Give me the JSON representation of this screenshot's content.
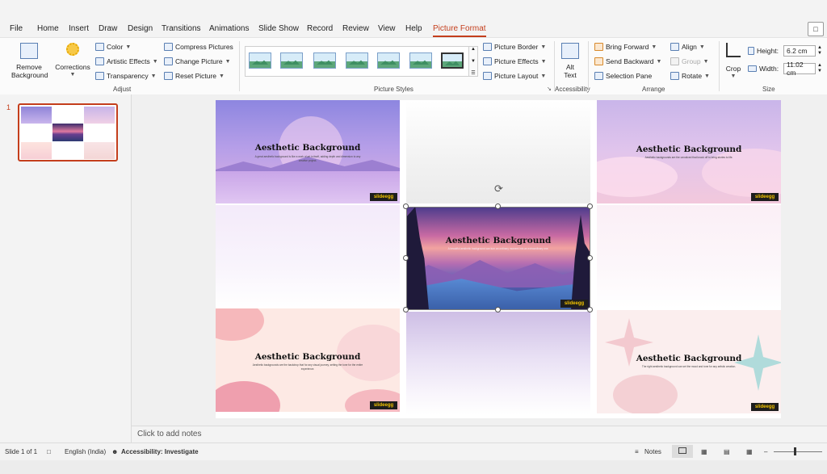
{
  "menu": {
    "tabs": [
      "File",
      "Home",
      "Insert",
      "Draw",
      "Design",
      "Transitions",
      "Animations",
      "Slide Show",
      "Record",
      "Review",
      "View",
      "Help",
      "Picture Format"
    ],
    "active_tab": "Picture Format"
  },
  "ribbon": {
    "adjust": {
      "remove_bg": "Remove Background",
      "remove_bg_l1": "Remove",
      "remove_bg_l2": "Background",
      "corrections": "Corrections",
      "color": "Color",
      "artistic": "Artistic Effects",
      "transparency": "Transparency",
      "compress": "Compress Pictures",
      "change": "Change Picture",
      "reset": "Reset Picture",
      "label": "Adjust"
    },
    "styles": {
      "border": "Picture Border",
      "effects": "Picture Effects",
      "layout": "Picture Layout",
      "label": "Picture Styles"
    },
    "accessibility": {
      "alt1": "Alt",
      "alt2": "Text",
      "label": "Accessibility"
    },
    "arrange": {
      "bring_forward": "Bring Forward",
      "send_backward": "Send Backward",
      "selection_pane": "Selection Pane",
      "align": "Align",
      "group": "Group",
      "rotate": "Rotate",
      "label": "Arrange"
    },
    "size": {
      "crop": "Crop",
      "height_label": "Height:",
      "height_value": "6.2 cm",
      "width_label": "Width:",
      "width_value": "11.02 cm",
      "label": "Size"
    }
  },
  "thumbnail": {
    "number": "1"
  },
  "slide": {
    "cards": [
      {
        "title": "Aesthetic Background",
        "desc": "A great aesthetic background is like a work of art in itself, adding depth and dimension to any creative project.",
        "logo": "slideegg"
      },
      {
        "title": "Aesthetic Background",
        "desc": "Aesthetic backgrounds are the unnoticed that knock off to bring stories to life.",
        "logo": "slideegg"
      },
      {
        "title": "Aesthetic Background",
        "desc": "A beautiful aesthetic background can turn an ordinary moment into an extraordinary one.",
        "logo": "slideegg"
      },
      {
        "title": "Aesthetic Background",
        "desc": "Aesthetic backgrounds are the backdrop that for any visual journey, setting the tone for the entire experience.",
        "logo": "slideegg"
      },
      {
        "title": "Aesthetic Background",
        "desc": "The right aesthetic background can set the mood and tone for any artistic creation.",
        "logo": "slideegg"
      }
    ]
  },
  "notes": {
    "placeholder": "Click to add notes"
  },
  "status": {
    "slide": "Slide 1 of 1",
    "language": "English (India)",
    "accessibility": "Accessibility: Investigate",
    "notes": "Notes"
  }
}
